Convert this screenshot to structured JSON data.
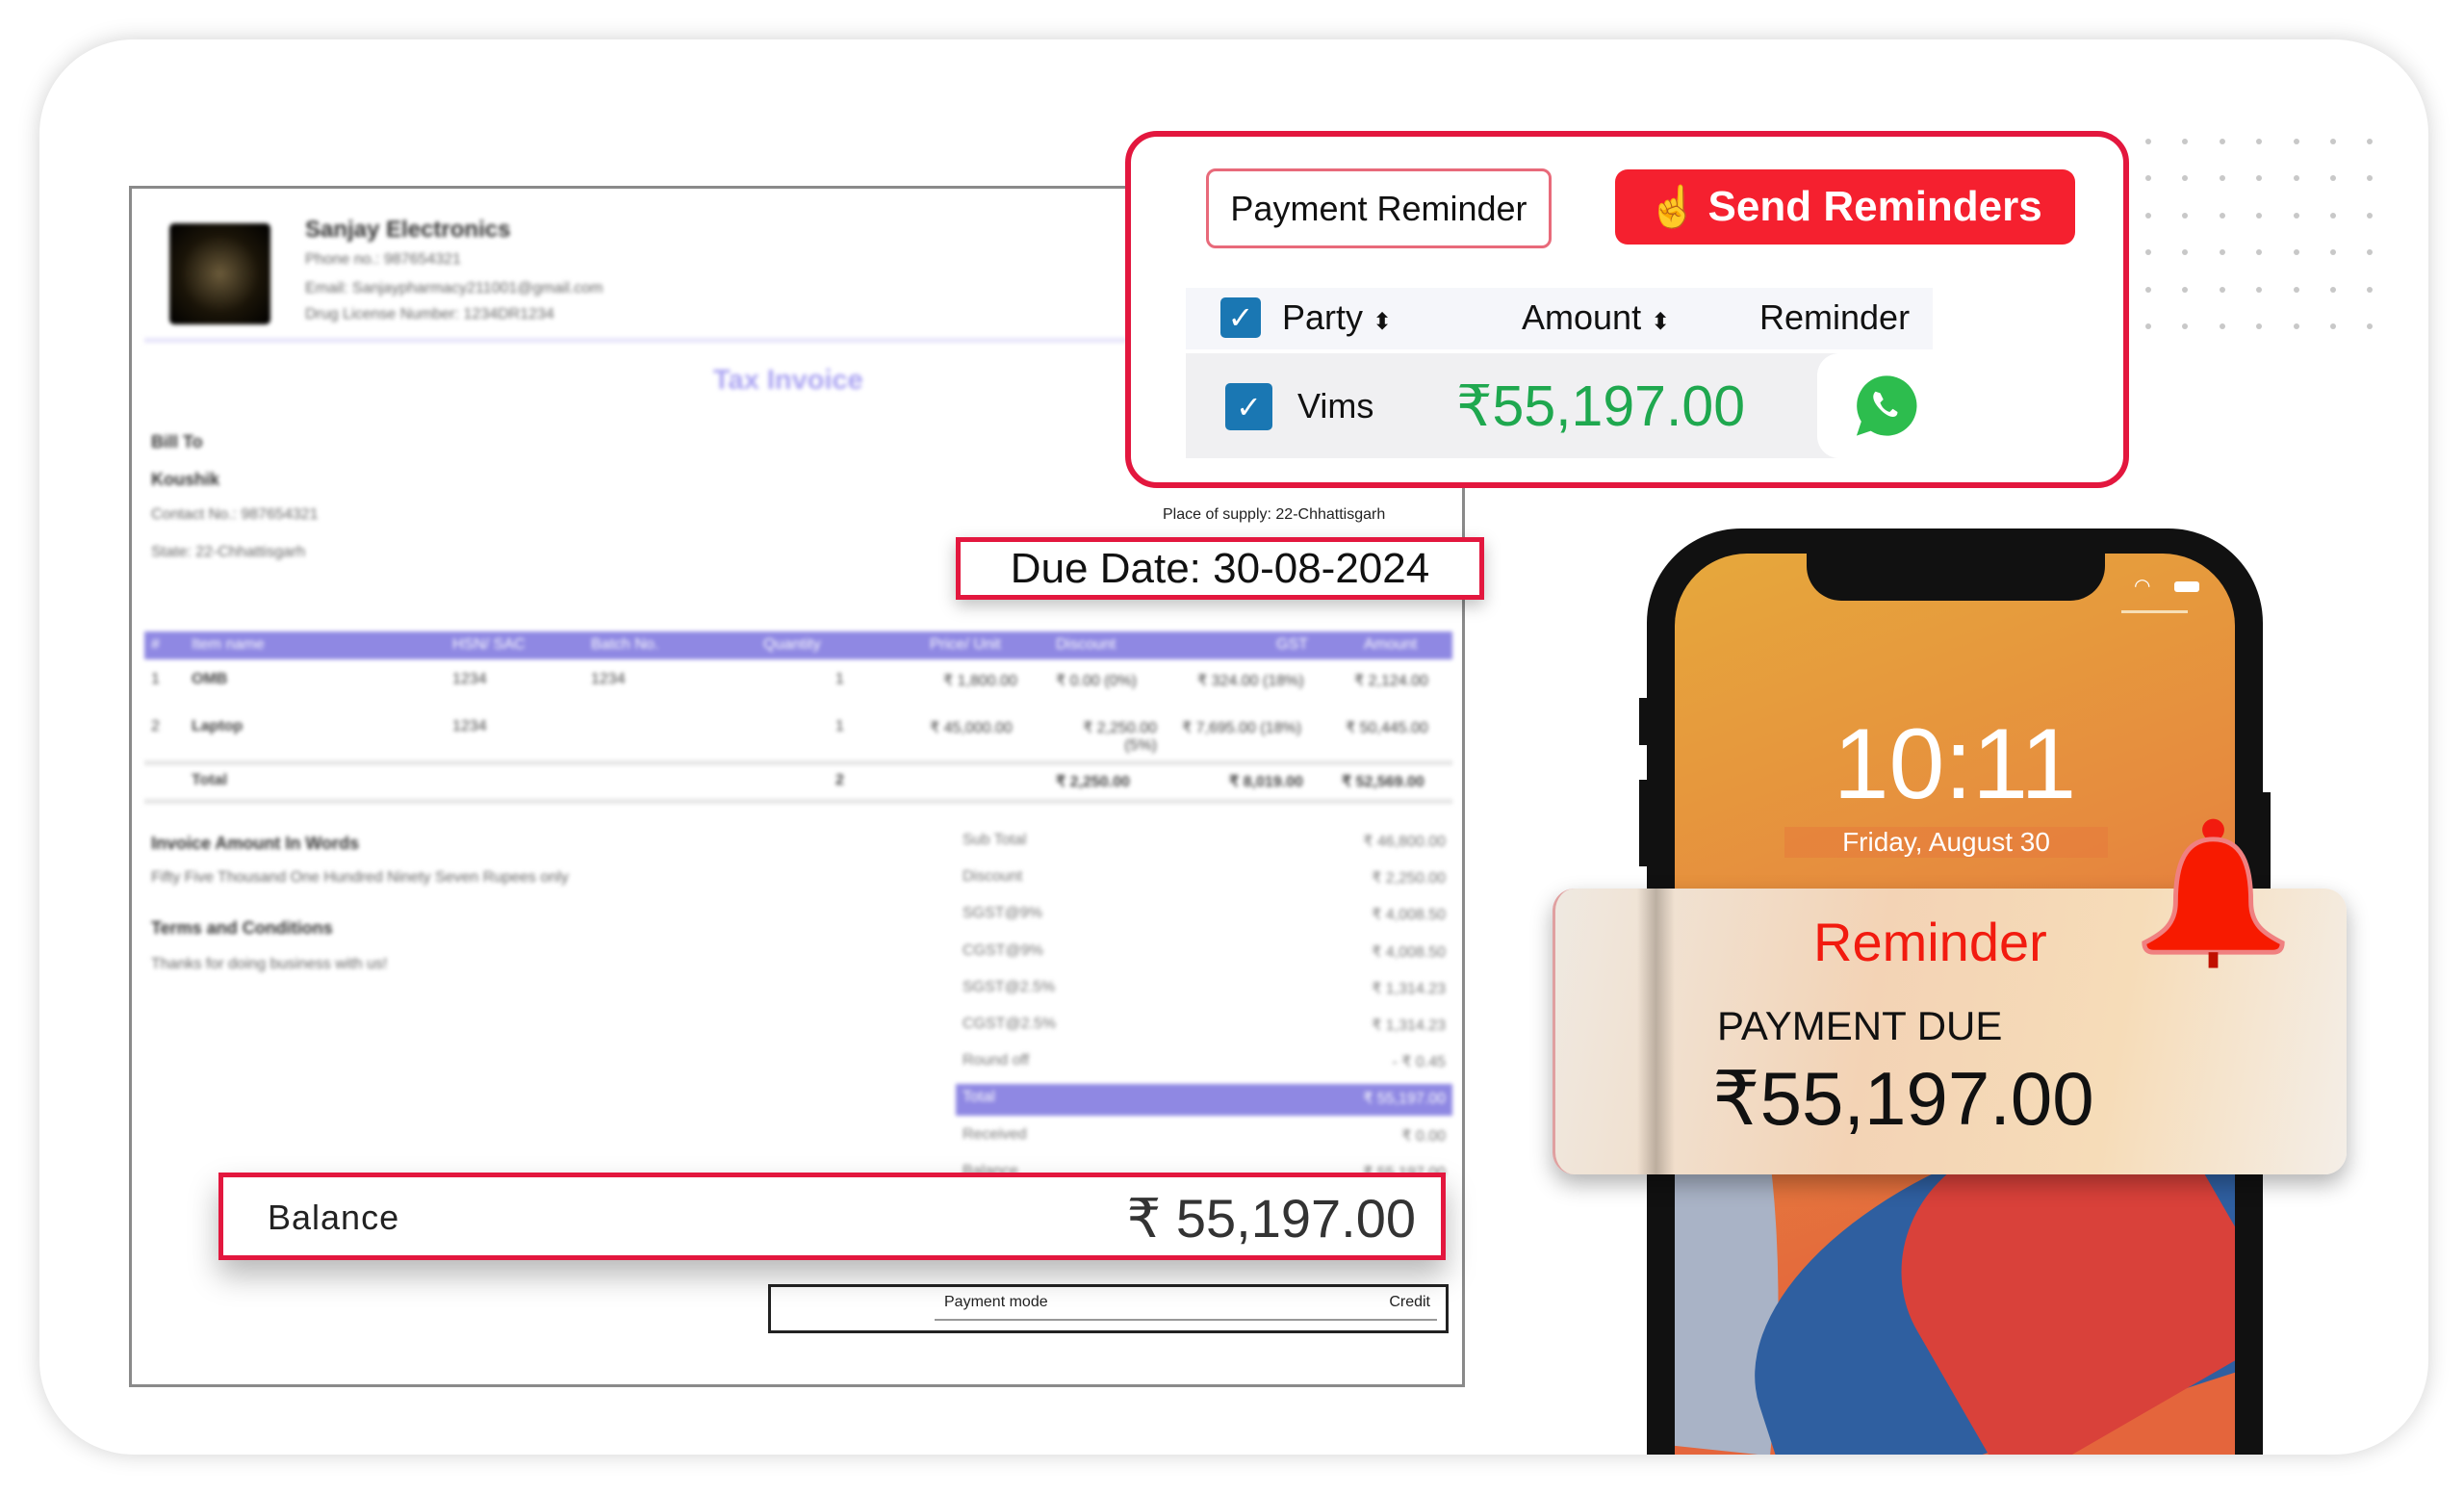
{
  "invoice": {
    "company": "Sanjay Electronics",
    "phone": "Phone no.: 987654321",
    "email": "Email: Sanjaypharmacy211001@gmail.com",
    "license": "Drug License Number: 1234DR1234",
    "title": "Tax Invoice",
    "bill_to_label": "Bill To",
    "customer": "Koushik",
    "contact": "Contact No.: 987654321",
    "state": "State: 22-Chhattisgarh",
    "place_of_supply": "Place of supply: 22-Chhattisgarh",
    "due_date": "Due Date: 30-08-2024",
    "columns": [
      "#",
      "Item name",
      "HSN/ SAC",
      "Batch No.",
      "Quantity",
      "Price/ Unit",
      "Discount",
      "GST",
      "Amount"
    ],
    "rows": [
      [
        "1",
        "OMB",
        "1234",
        "1234",
        "1",
        "₹ 1,800.00",
        "₹ 0.00 (0%)",
        "₹ 324.00 (18%)",
        "₹ 2,124.00"
      ],
      [
        "2",
        "Laptop",
        "1234",
        "",
        "1",
        "₹ 45,000.00",
        "₹ 2,250.00 (5%)",
        "₹ 7,695.00 (18%)",
        "₹ 50,445.00"
      ]
    ],
    "total_row": [
      "",
      "Total",
      "",
      "",
      "2",
      "",
      "₹ 2,250.00",
      "₹ 8,019.00",
      "₹ 52,569.00"
    ],
    "words_label": "Invoice Amount In Words",
    "words": "Fifty Five Thousand One Hundred Ninety Seven Rupees only",
    "terms_label": "Terms and Conditions",
    "terms": "Thanks for doing business with us!",
    "summary": [
      {
        "label": "Sub Total",
        "value": "₹ 46,800.00"
      },
      {
        "label": "Discount",
        "value": "₹ 2,250.00"
      },
      {
        "label": "SGST@9%",
        "value": "₹ 4,008.50"
      },
      {
        "label": "CGST@9%",
        "value": "₹ 4,008.50"
      },
      {
        "label": "SGST@2.5%",
        "value": "₹ 1,314.23"
      },
      {
        "label": "CGST@2.5%",
        "value": "₹ 1,314.23"
      },
      {
        "label": "Round off",
        "value": "- ₹ 0.45"
      },
      {
        "label": "Total",
        "value": "₹ 55,197.00"
      },
      {
        "label": "Received",
        "value": "₹ 0.00"
      },
      {
        "label": "Balance",
        "value": "₹ 55,197.00"
      }
    ],
    "balance_label": "Balance",
    "balance_value": "₹ 55,197.00",
    "payment_mode_label": "Payment mode",
    "payment_mode": "Credit"
  },
  "reminder_panel": {
    "title_button": "Payment Reminder",
    "send_button": "Send Reminders",
    "col_party": "Party",
    "col_amount": "Amount",
    "col_reminder": "Reminder",
    "row_party": "Vims",
    "row_amount": "₹55,197.00",
    "amount_color": "#1fa84f",
    "accent": "#e3173e"
  },
  "phone": {
    "time": "10:11",
    "date": "Friday, August 30",
    "notif_title": "Reminder",
    "notif_subtitle": "PAYMENT DUE",
    "notif_amount": "₹55,197.00"
  }
}
